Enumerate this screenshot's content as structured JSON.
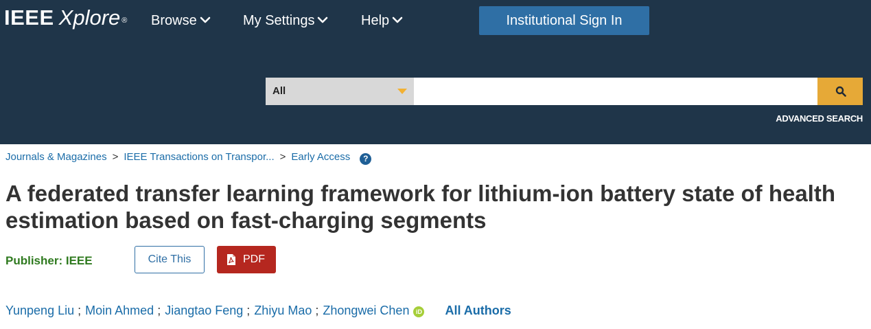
{
  "header": {
    "logo_primary": "IEEE",
    "logo_secondary": "Xplore",
    "logo_mark": "®",
    "nav": [
      {
        "label": "Browse",
        "icon": "chevron-down-icon"
      },
      {
        "label": "My Settings",
        "icon": "chevron-down-icon"
      },
      {
        "label": "Help",
        "icon": "chevron-down-icon"
      }
    ],
    "signin_label": "Institutional Sign In",
    "background_color": "#1f3549",
    "signin_color": "#2f6fa5"
  },
  "search": {
    "scope_value": "All",
    "query": "",
    "button_icon": "search-icon",
    "button_color": "#e6a937",
    "advanced_label": "ADVANCED SEARCH"
  },
  "breadcrumb": {
    "items": [
      "Journals & Magazines",
      "IEEE Transactions on Transpor...",
      "Early Access"
    ],
    "separator": ">",
    "help_icon": "question-circle-icon"
  },
  "article": {
    "title": "A federated transfer learning framework for lithium-ion battery state of health estimation based on fast-charging segments",
    "publisher_label": "Publisher:",
    "publisher_name": "IEEE",
    "cite_label": "Cite This",
    "pdf_label": "PDF",
    "pdf_color": "#b5271f",
    "authors": [
      "Yunpeng Liu",
      "Moin Ahmed",
      "Jiangtao Feng",
      "Zhiyu Mao",
      "Zhongwei Chen"
    ],
    "author_separator": ";",
    "orcid_label": "iD",
    "all_authors_label": "All Authors"
  }
}
